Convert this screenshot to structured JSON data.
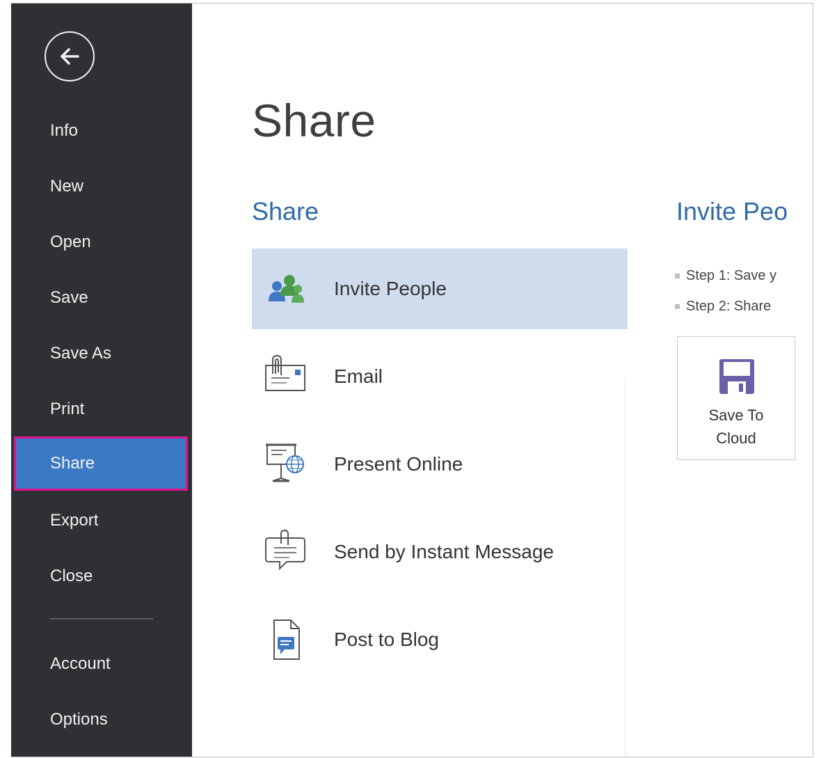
{
  "sidebar": {
    "items": [
      {
        "label": "Info"
      },
      {
        "label": "New"
      },
      {
        "label": "Open"
      },
      {
        "label": "Save"
      },
      {
        "label": "Save As"
      },
      {
        "label": "Print"
      },
      {
        "label": "Share"
      },
      {
        "label": "Export"
      },
      {
        "label": "Close"
      },
      {
        "label": "Account"
      },
      {
        "label": "Options"
      }
    ],
    "active": "Share",
    "back_icon": "back-arrow-icon"
  },
  "main": {
    "title": "Share",
    "section_heading": "Share",
    "options": [
      {
        "label": "Invite People",
        "icon": "people-icon",
        "selected": true
      },
      {
        "label": "Email",
        "icon": "email-icon",
        "selected": false
      },
      {
        "label": "Present Online",
        "icon": "present-online-icon",
        "selected": false
      },
      {
        "label": "Send by Instant Message",
        "icon": "instant-message-icon",
        "selected": false
      },
      {
        "label": "Post to Blog",
        "icon": "blog-icon",
        "selected": false
      }
    ]
  },
  "detail": {
    "heading": "Invite Peo",
    "steps": [
      "Step 1: Save y",
      "Step 2: Share"
    ],
    "save_to_cloud": {
      "line1": "Save To",
      "line2": "Cloud",
      "icon": "floppy-disk-icon"
    }
  },
  "colors": {
    "sidebar_bg": "#2f3033",
    "active_item": "#3c79c4",
    "highlight_border": "#e0148e",
    "heading_blue": "#2f6aa8",
    "selected_option": "#cfdcee",
    "disk_purple": "#6b5fa8"
  }
}
